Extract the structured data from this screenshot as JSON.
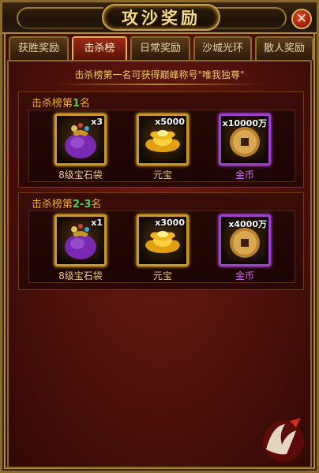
{
  "header": {
    "title": "攻沙奖励",
    "close_label": "✕"
  },
  "tabs": [
    {
      "label": "获胜奖励",
      "active": false
    },
    {
      "label": "击杀榜",
      "active": true
    },
    {
      "label": "日常奖励",
      "active": false
    },
    {
      "label": "沙城光环",
      "active": false
    },
    {
      "label": "散人奖励",
      "active": false
    }
  ],
  "hint": "击杀榜第一名可获得巅峰称号\"唯我独尊\"",
  "sections": [
    {
      "title_prefix": "击杀榜第",
      "rank": "1",
      "title_suffix": "名",
      "items": [
        {
          "name": "8级宝石袋",
          "qty": "x3",
          "icon": "gem-bag-icon"
        },
        {
          "name": "元宝",
          "qty": "x5000",
          "icon": "gold-ingot-icon"
        },
        {
          "name": "金币",
          "qty": "x10000万",
          "icon": "gold-coin-icon"
        }
      ]
    },
    {
      "title_prefix": "击杀榜第",
      "rank": "2-3",
      "title_suffix": "名",
      "items": [
        {
          "name": "8级宝石袋",
          "qty": "x1",
          "icon": "gem-bag-icon"
        },
        {
          "name": "元宝",
          "qty": "x3000",
          "icon": "gold-ingot-icon"
        },
        {
          "name": "金币",
          "qty": "x4000万",
          "icon": "gold-coin-icon"
        }
      ]
    }
  ],
  "colors": {
    "gold_border": "#c9962a",
    "purple_border": "#a040d0",
    "rank_green": "#4cd24c",
    "section_title": "#f0b030"
  }
}
